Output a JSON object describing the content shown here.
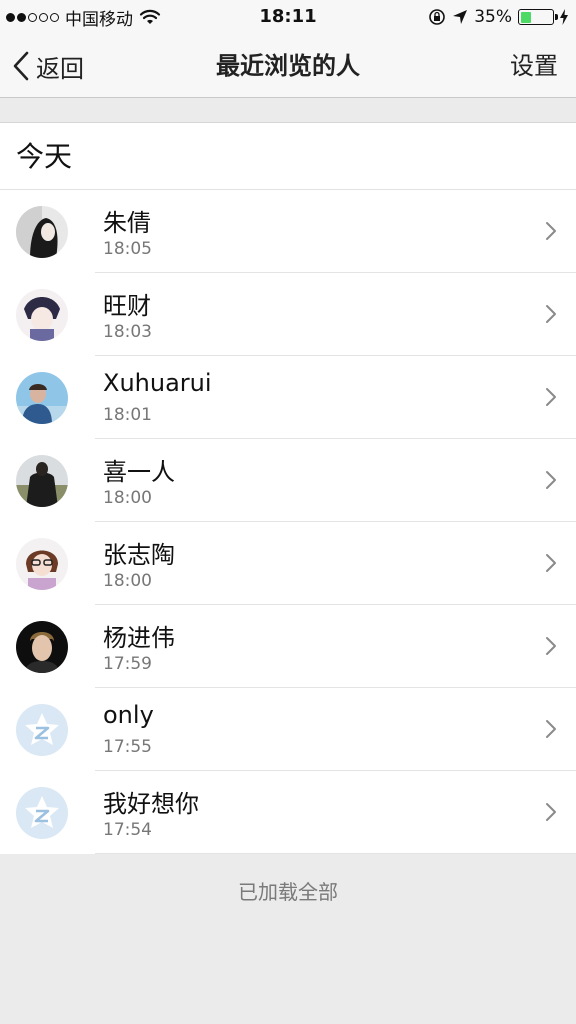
{
  "status_bar": {
    "carrier": "中国移动",
    "time": "18:11",
    "battery_percent": "35%",
    "battery_level": 0.35,
    "signal_strength": 2,
    "icons": [
      "wifi-icon",
      "rotation-lock-icon",
      "location-arrow-icon",
      "battery-icon",
      "charging-bolt-icon"
    ]
  },
  "nav": {
    "back_label": "返回",
    "title": "最近浏览的人",
    "settings_label": "设置"
  },
  "section": {
    "title": "今天"
  },
  "visitors": [
    {
      "name": "朱倩",
      "time": "18:05",
      "avatar": "photo-avatar"
    },
    {
      "name": "旺财",
      "time": "18:03",
      "avatar": "photo-avatar"
    },
    {
      "name": "Xuhuarui",
      "time": "18:01",
      "avatar": "photo-avatar"
    },
    {
      "name": "喜一人",
      "time": "18:00",
      "avatar": "photo-avatar"
    },
    {
      "name": "张志陶",
      "time": "18:00",
      "avatar": "photo-avatar"
    },
    {
      "name": "杨进伟",
      "time": "17:59",
      "avatar": "photo-avatar"
    },
    {
      "name": "only",
      "time": "17:55",
      "avatar": "default-qzone-avatar"
    },
    {
      "name": "我好想你",
      "time": "17:54",
      "avatar": "default-qzone-avatar"
    }
  ],
  "footer": {
    "load_all_label": "已加载全部"
  },
  "colors": {
    "bar_background": "#f7f7f7",
    "page_background": "#ebebeb",
    "battery_fill": "#4cd964",
    "secondary_text": "#777777"
  }
}
